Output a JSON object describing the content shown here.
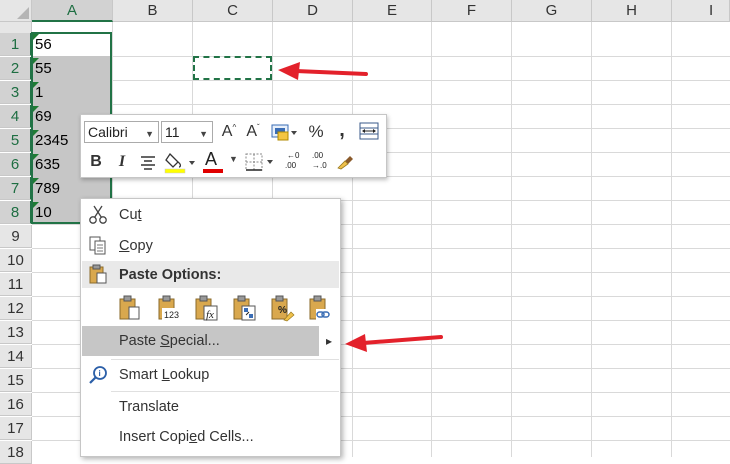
{
  "columns": [
    "A",
    "B",
    "C",
    "D",
    "E",
    "F",
    "G",
    "H",
    "I"
  ],
  "rows": [
    "1",
    "2",
    "3",
    "4",
    "5",
    "6",
    "7",
    "8",
    "9",
    "10",
    "11",
    "12",
    "13",
    "14",
    "15",
    "16",
    "17",
    "18"
  ],
  "cells_a": [
    "56",
    "55",
    "1",
    "69",
    "2345",
    "635",
    "789",
    "10"
  ],
  "mini_toolbar": {
    "font_name": "Calibri",
    "font_size": "11",
    "increase_font_label": "A",
    "decrease_font_label": "A",
    "percent_label": "%",
    "comma_label": ",",
    "bold_label": "B",
    "italic_label": "I",
    "font_color_label": "A",
    "inc_decimal_label": ".00",
    "dec_decimal_label": ".00",
    "font_color_bar": "#e00000",
    "fill_color_bar": "#ffff00"
  },
  "context_menu": {
    "cut": {
      "pre": "Cu",
      "acc": "t",
      "post": ""
    },
    "copy": {
      "pre": "",
      "acc": "C",
      "post": "opy"
    },
    "paste_options": "Paste Options:",
    "paste_special": {
      "pre": "Paste ",
      "acc": "S",
      "post": "pecial..."
    },
    "smart_lookup": {
      "pre": "Smart ",
      "acc": "L",
      "post": "ookup"
    },
    "translate": "Translate",
    "insert_copied": {
      "pre": "Insert Copi",
      "acc": "e",
      "post": "d Cells..."
    },
    "submenu_arrow": "▸"
  },
  "colors": {
    "accent": "#217346",
    "arrow": "#e3212b"
  }
}
